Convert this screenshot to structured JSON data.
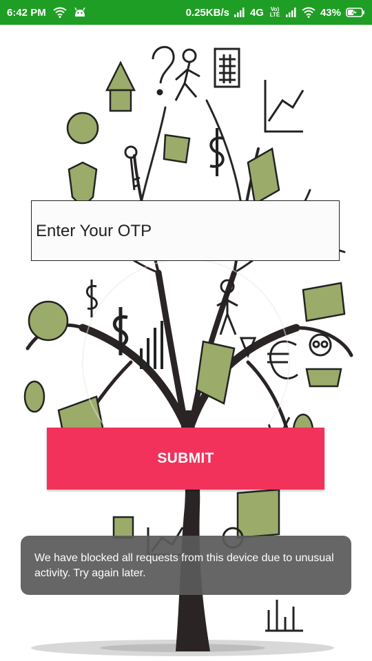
{
  "status_bar": {
    "time": "6:42 PM",
    "network_speed": "0.25KB/s",
    "network_type": "4G",
    "volte_label": "Vo) LTE",
    "battery_percent": "43%",
    "icons": [
      "wifi-icon",
      "notification-app-icon",
      "signal-icon",
      "volte-icon",
      "signal-icon",
      "wifi-icon",
      "battery-charging-icon"
    ],
    "battery_level": 0.43,
    "background_color": "#1f9e25"
  },
  "background": {
    "description_icon": "money-tree-illustration",
    "accent_color": "#9bab6a"
  },
  "otp": {
    "placeholder": "Enter Your OTP"
  },
  "submit": {
    "label": "SUBMIT",
    "color": "#f2325a"
  },
  "toast": {
    "message": "We have blocked all requests from this device due to unusual activity. Try again later."
  }
}
